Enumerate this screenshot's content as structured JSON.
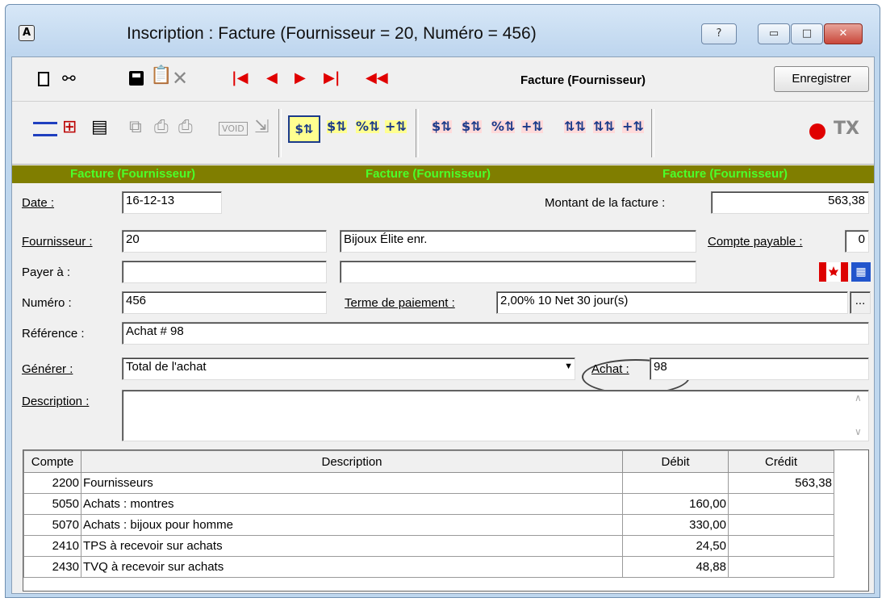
{
  "window": {
    "title": "Inscription : Facture (Fournisseur = 20, Numéro = 456)",
    "app_icon": "A",
    "help_label": "?",
    "minimize_label": "▭",
    "maximize_label": "□",
    "close_label": "✕"
  },
  "toolbar": {
    "form_label": "Facture (Fournisseur)",
    "save_label": "Enregistrer",
    "icons": [
      "new-document-icon",
      "binoculars-icon",
      "save-disk-icon",
      "copy-paste-icon",
      "delete-x-icon",
      "first-record-icon",
      "previous-record-icon",
      "next-record-icon",
      "last-record-icon",
      "rewind-icon"
    ]
  },
  "toolbar2": {
    "tx_label": "TX",
    "void_label": "VOID"
  },
  "banner": {
    "left": "Facture (Fournisseur)",
    "center": "Facture (Fournisseur)",
    "right": "Facture (Fournisseur)"
  },
  "form": {
    "date_label": "Date :",
    "date_value": "16-12-13",
    "montant_label": "Montant de la facture :",
    "montant_value": "563,38",
    "fournisseur_label": "Fournisseur :",
    "fournisseur_value": "20",
    "fournisseur_name": "Bijoux Élite enr.",
    "compte_payable_label": "Compte payable :",
    "compte_payable_value": "0",
    "payer_label": "Payer à :",
    "payer_value": "",
    "payer_name": "",
    "numero_label": "Numéro :",
    "numero_value": "456",
    "terme_label": "Terme de paiement :",
    "terme_value": "2,00% 10 Net 30 jour(s)",
    "terme_button": "...",
    "reference_label": "Référence :",
    "reference_value": "Achat # 98",
    "generer_label": "Générer :",
    "generer_value": "Total de l'achat",
    "achat_label": "Achat :",
    "achat_value": "98",
    "description_label": "Description :",
    "description_value": ""
  },
  "grid": {
    "headers": [
      "Compte",
      "Description",
      "Débit",
      "Crédit"
    ],
    "rows": [
      {
        "compte": "2200",
        "description": "Fournisseurs",
        "debit": "",
        "credit": "563,38"
      },
      {
        "compte": "5050",
        "description": "Achats : montres",
        "debit": "160,00",
        "credit": ""
      },
      {
        "compte": "5070",
        "description": "Achats : bijoux pour homme",
        "debit": "330,00",
        "credit": ""
      },
      {
        "compte": "2410",
        "description": "TPS à recevoir sur achats",
        "debit": "24,50",
        "credit": ""
      },
      {
        "compte": "2430",
        "description": "TVQ à recevoir sur achats",
        "debit": "48,88",
        "credit": ""
      }
    ]
  },
  "colors": {
    "banner_bg": "#807e00",
    "banner_text": "#4bff2a",
    "nav_red": "#e00000"
  }
}
